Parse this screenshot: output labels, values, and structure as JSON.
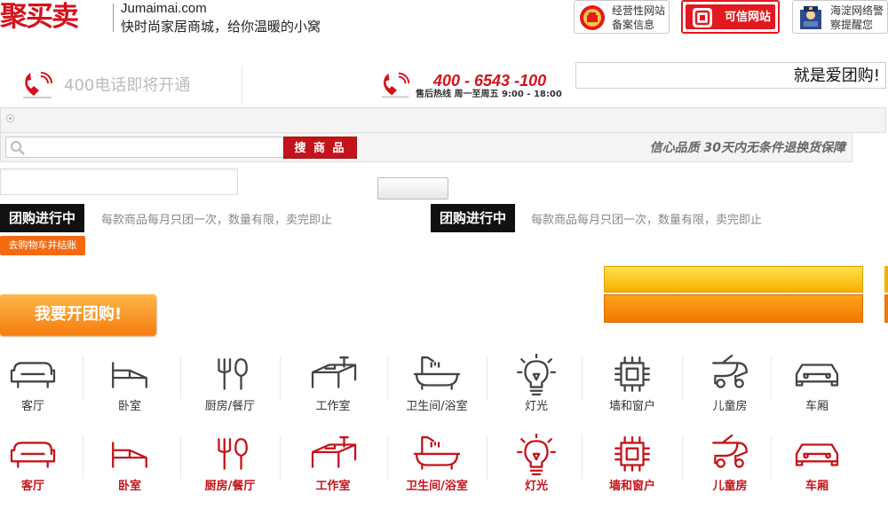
{
  "header": {
    "logo_text": "聚买卖",
    "domain": "Jumaimai.com",
    "slogan": "快时尚家居商城，给你温暖的小窝",
    "badges": [
      {
        "line1": "经营性网站",
        "line2": "备案信息"
      },
      {
        "label": "可信网站"
      },
      {
        "line1": "海淀网络警",
        "line2": "察提醒您"
      }
    ]
  },
  "hotline": {
    "coming_soon": "400电话即将开通",
    "number": "400 - 6543 -100",
    "sub": "售后热线   周一至周五  9:00 - 18:00",
    "ad_text": "就是爱团购!"
  },
  "search": {
    "button_label": "搜 商 品",
    "promise": "信心品质  30天内无条件退换货保障"
  },
  "groupbuy": {
    "label": "团购进行中",
    "desc": "每款商品每月只团一次，数量有限，卖完即止",
    "checkout": "去购物车并结账",
    "start_button": "我要开团购!"
  },
  "categories": [
    "客厅",
    "卧室",
    "厨房/餐厅",
    "工作室",
    "卫生间/浴室",
    "灯光",
    "墙和窗户",
    "儿童房",
    "车厢"
  ],
  "colors": {
    "brand_red": "#c4141b",
    "orange": "#f57d0f",
    "icon_gray": "#444"
  }
}
